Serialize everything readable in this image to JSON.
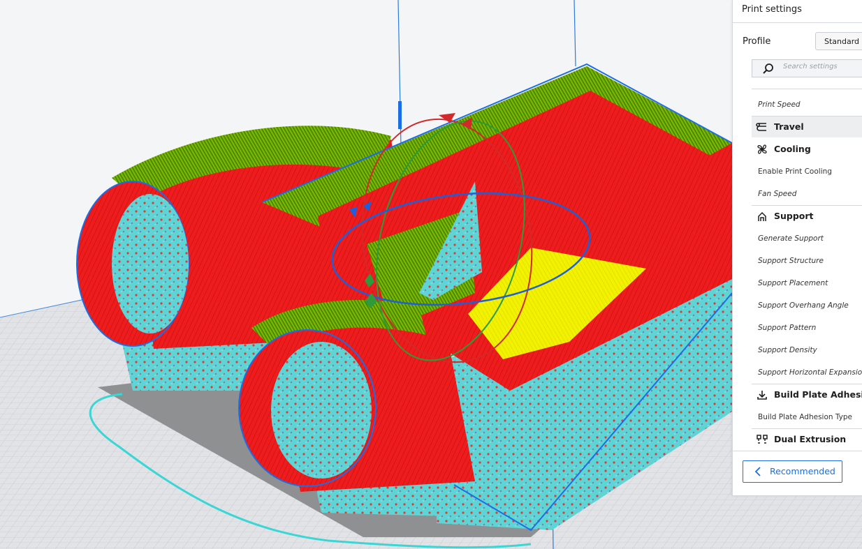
{
  "panel": {
    "title": "Print settings",
    "profile_label": "Profile",
    "profile_value": "Standard Q",
    "search_placeholder": "Search settings"
  },
  "settings": {
    "print_speed": "Print Speed",
    "travel": "Travel",
    "cooling": "Cooling",
    "enable_print_cooling": "Enable Print Cooling",
    "fan_speed": "Fan Speed",
    "support": "Support",
    "generate_support": "Generate Support",
    "support_structure": "Support Structure",
    "support_placement": "Support Placement",
    "support_overhang_angle": "Support Overhang Angle",
    "support_pattern": "Support Pattern",
    "support_density": "Support Density",
    "support_horizontal_expansion": "Support Horizontal Expansion",
    "build_plate_adhesion": "Build Plate Adhesion",
    "build_plate_adhesion_type": "Build Plate Adhesion Type",
    "dual_extrusion": "Dual Extrusion"
  },
  "footer": {
    "recommended_label": "Recommended"
  },
  "icons": {
    "search": "search-icon",
    "travel": "travel-icon",
    "cooling": "fan-icon",
    "support": "support-icon",
    "adhesion": "adhesion-icon",
    "dual": "dual-extrusion-icon",
    "back": "chevron-left-icon"
  },
  "colors": {
    "accent": "#1a6ee6",
    "wall_red": "#ee1c1c",
    "infill_green": "#5ea300",
    "top_yellow": "#f2f200",
    "support_cyan": "#5fd4d4",
    "build_plate": "#dedfe3"
  }
}
